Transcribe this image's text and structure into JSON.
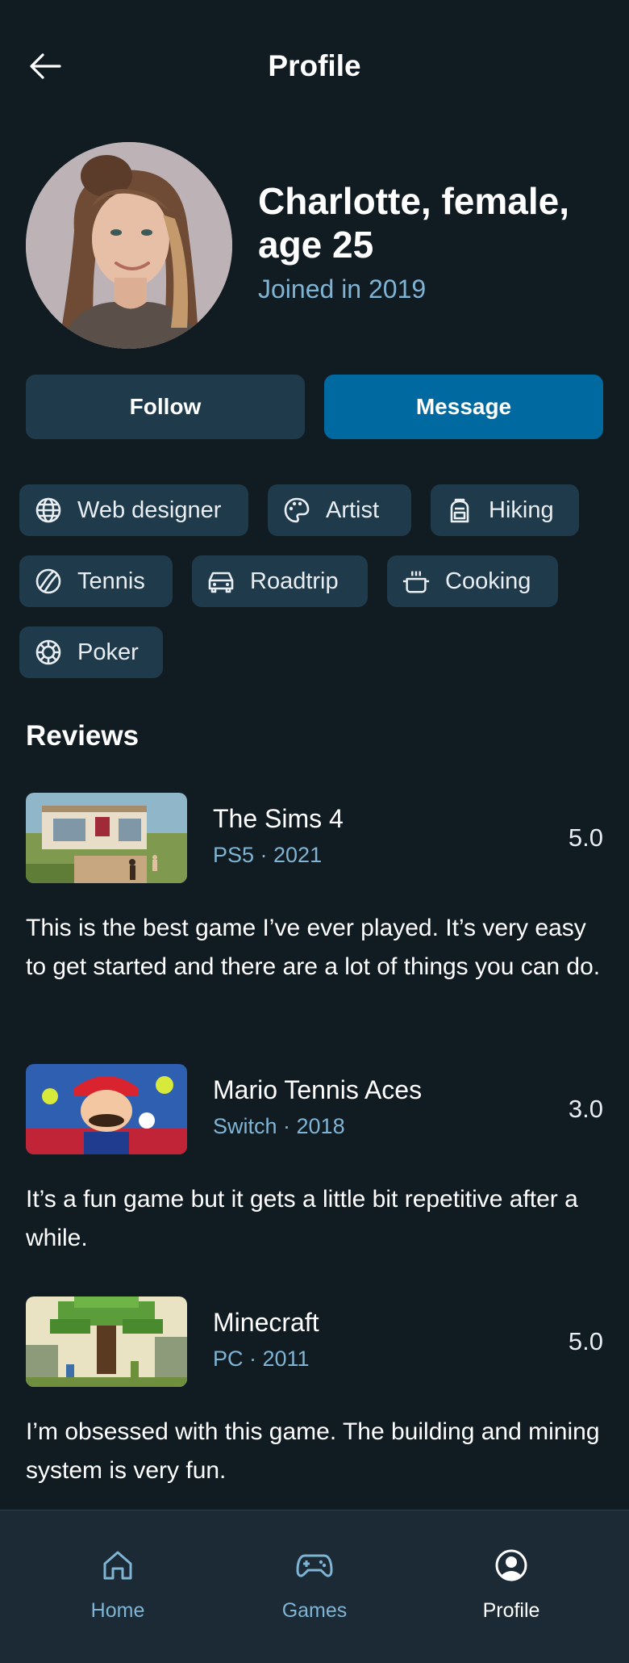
{
  "header": {
    "title": "Profile",
    "back_icon": "arrow-left-icon"
  },
  "profile": {
    "name": "Charlotte, female, age 25",
    "joined": "Joined in 2019"
  },
  "actions": {
    "follow_label": "Follow",
    "message_label": "Message"
  },
  "tags": [
    {
      "label": "Web designer",
      "icon": "globe-icon"
    },
    {
      "label": "Artist",
      "icon": "palette-icon"
    },
    {
      "label": "Hiking",
      "icon": "backpack-icon"
    },
    {
      "label": "Tennis",
      "icon": "tennis-ball-icon"
    },
    {
      "label": "Roadtrip",
      "icon": "car-icon"
    },
    {
      "label": "Cooking",
      "icon": "cooking-pot-icon"
    },
    {
      "label": "Poker",
      "icon": "poker-chip-icon"
    }
  ],
  "reviews": {
    "title": "Reviews",
    "items": [
      {
        "game": "The Sims 4",
        "meta": "PS5 · 2021",
        "score": "5.0",
        "text": "This is the best game I’ve ever played. It’s very easy to get started and there are a lot of things you can do."
      },
      {
        "game": "Mario Tennis Aces",
        "meta": "Switch · 2018",
        "score": "3.0",
        "text": "It’s a fun game but it gets a little bit repetitive after a while."
      },
      {
        "game": "Minecraft",
        "meta": "PC · 2011",
        "score": "5.0",
        "text": "I’m obsessed with this game. The building and mining system is very fun."
      }
    ]
  },
  "nav": {
    "items": [
      {
        "label": "Home",
        "icon": "home-icon"
      },
      {
        "label": "Games",
        "icon": "gamepad-icon"
      },
      {
        "label": "Profile",
        "icon": "user-circle-icon"
      }
    ],
    "active": "Profile"
  },
  "colors": {
    "background": "#111b22",
    "surface": "#1f3a4a",
    "accent": "#0069a0",
    "muted_text": "#7fb4d4"
  }
}
